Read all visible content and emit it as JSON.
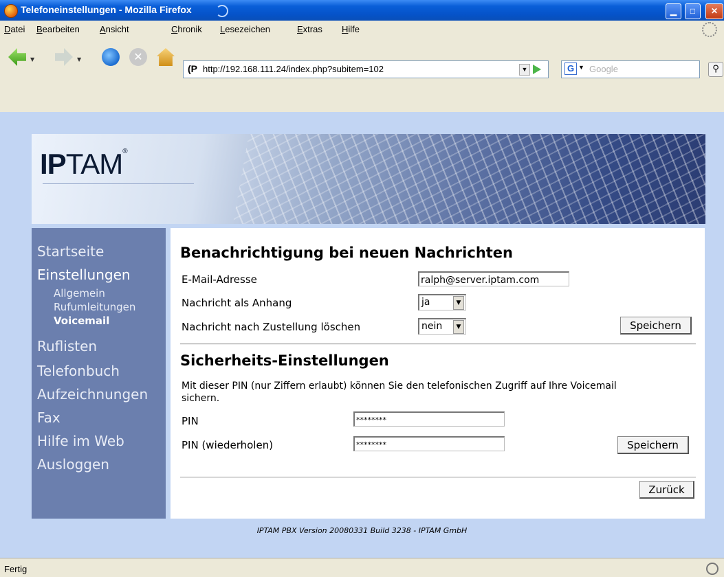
{
  "window": {
    "title": "Telefoneinstellungen - Mozilla Firefox"
  },
  "menubar": [
    "Datei",
    "Bearbeiten",
    "Ansicht",
    "Chronik",
    "Lesezeichen",
    "Extras",
    "Hilfe"
  ],
  "toolbar": {
    "url": "http://192.168.111.24/index.php?subitem=102",
    "search_placeholder": "Google"
  },
  "banner": {
    "logo": "IPTAM",
    "logo_bold": "IP",
    "logo_rest": "TAM"
  },
  "sidebar": {
    "items": [
      {
        "label": "Startseite"
      },
      {
        "label": "Einstellungen"
      },
      {
        "label": "Allgemein"
      },
      {
        "label": "Rufumleitungen"
      },
      {
        "label": "Voicemail"
      },
      {
        "label": "Ruflisten"
      },
      {
        "label": "Telefonbuch"
      },
      {
        "label": "Aufzeichnungen"
      },
      {
        "label": "Fax"
      },
      {
        "label": "Hilfe im Web"
      },
      {
        "label": "Ausloggen"
      }
    ]
  },
  "notify": {
    "heading": "Benachrichtigung bei neuen Nachrichten",
    "email_label": "E-Mail-Adresse",
    "email_value": "ralph@server.iptam.com",
    "attach_label": "Nachricht als Anhang",
    "attach_value": "ja",
    "delete_label": "Nachricht nach Zustellung löschen",
    "delete_value": "nein",
    "save_label": "Speichern"
  },
  "security": {
    "heading": "Sicherheits-Einstellungen",
    "description": "Mit dieser PIN (nur Ziffern erlaubt) können Sie den telefonischen Zugriff auf Ihre Voicemail sichern.",
    "pin_label": "PIN",
    "pin_value": "********",
    "pin_repeat_label": "PIN (wiederholen)",
    "pin_repeat_value": "********",
    "save_label": "Speichern"
  },
  "back_label": "Zurück",
  "footer": "IPTAM PBX Version 20080331 Build 3238 - IPTAM GmbH",
  "status": "Fertig"
}
